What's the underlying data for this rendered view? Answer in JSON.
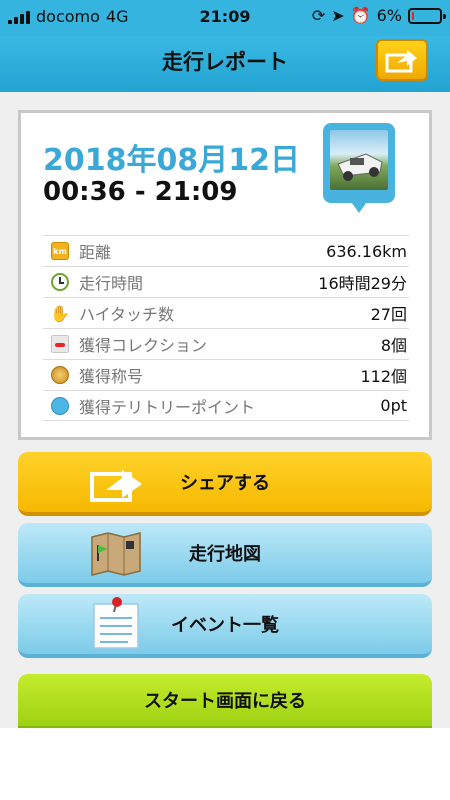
{
  "status_bar": {
    "carrier": "docomo",
    "network": "4G",
    "time": "21:09",
    "battery_percent_text": "6%",
    "battery_level": 0.06
  },
  "header": {
    "title": "走行レポート"
  },
  "report": {
    "date": "2018年08月12日",
    "time_range": "00:36 - 21:09",
    "stats": [
      {
        "icon": "km-icon",
        "label": "距離",
        "value": "636.16km"
      },
      {
        "icon": "clock-icon",
        "label": "走行時間",
        "value": "16時間29分"
      },
      {
        "icon": "hand-icon",
        "label": "ハイタッチ数",
        "value": "27回"
      },
      {
        "icon": "car-icon",
        "label": "獲得コレクション",
        "value": "8個"
      },
      {
        "icon": "medal-icon",
        "label": "獲得称号",
        "value": "112個"
      },
      {
        "icon": "spot-icon",
        "label": "獲得テリトリーポイント",
        "value": "0pt"
      }
    ]
  },
  "buttons": {
    "share": "シェアする",
    "map": "走行地図",
    "events": "イベント一覧",
    "back_to_start": "スタート画面に戻る"
  },
  "colors": {
    "header": "#34b4de",
    "date_text": "#3aa9d8",
    "share_button": "#ffd22a",
    "blue_button": "#7ccbe9",
    "green_button": "#a8db16"
  }
}
